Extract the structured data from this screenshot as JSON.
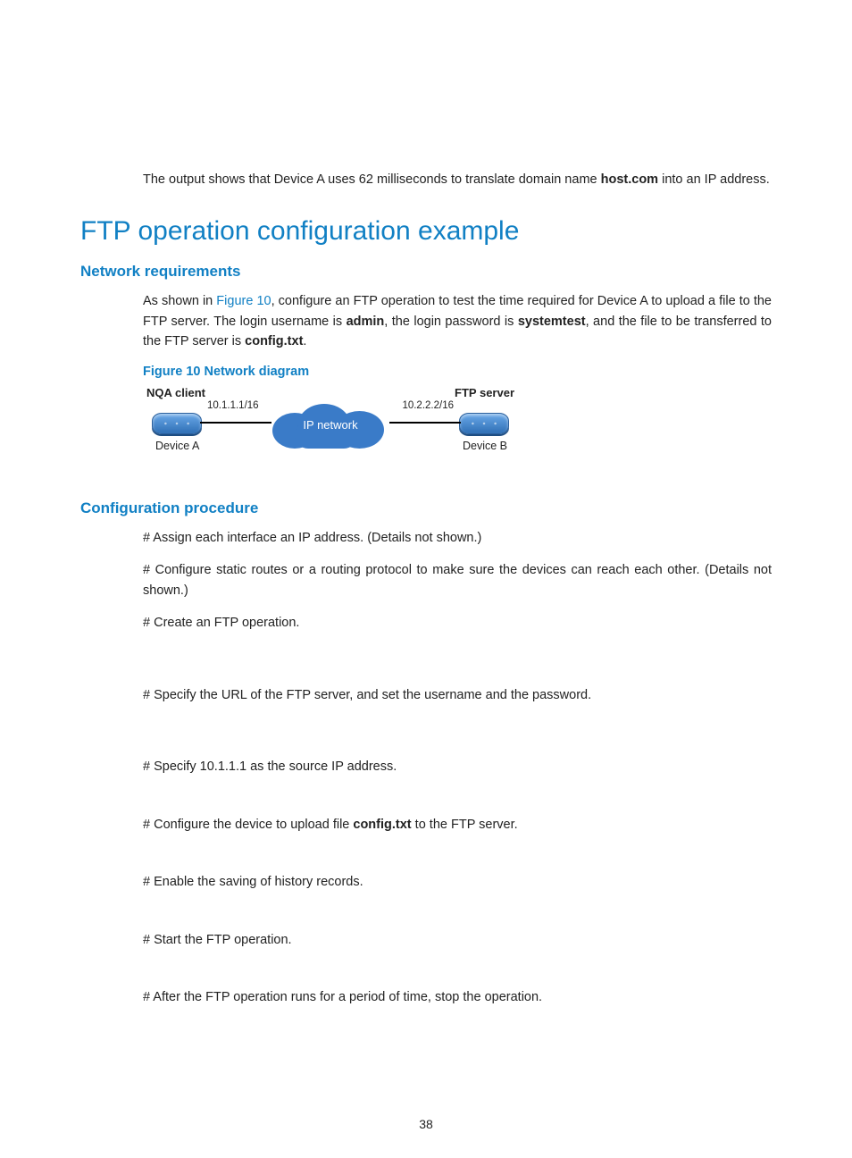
{
  "intro": {
    "pre": "The output shows that Device A uses 62 milliseconds to translate domain name ",
    "bold": "host.com",
    "post": " into an IP address."
  },
  "h2": "FTP operation configuration example",
  "netreq": {
    "title": "Network requirements",
    "p1a": "As shown in ",
    "link": "Figure 10",
    "p1b": ", configure an FTP operation to test the time required for Device A to upload a file to the FTP server. The login username is ",
    "b1": "admin",
    "p1c": ", the login password is ",
    "b2": "systemtest",
    "p1d": ", and the file to be transferred to the FTP server is ",
    "b3": "config.txt",
    "p1e": "."
  },
  "figcap": "Figure 10 Network diagram",
  "diagram": {
    "left_title": "NQA client",
    "right_title": "FTP server",
    "ip_a": "10.1.1.1/16",
    "ip_b": "10.2.2.2/16",
    "cloud": "IP network",
    "dev_a": "Device A",
    "dev_b": "Device B"
  },
  "proc": {
    "title": "Configuration procedure",
    "s1": "# Assign each interface an IP address. (Details not shown.)",
    "s2": "# Configure static routes or a routing protocol to make sure the devices can reach each other. (Details not shown.)",
    "s3": "# Create an FTP operation.",
    "s4": "# Specify the URL of the FTP server, and set the username and the password.",
    "s5": "# Specify 10.1.1.1 as the source IP address.",
    "s6a": "# Configure the device to upload file ",
    "s6b": "config.txt",
    "s6c": " to the FTP server.",
    "s7": "# Enable the saving of history records.",
    "s8": "# Start the FTP operation.",
    "s9": "# After the FTP operation runs for a period of time, stop the operation."
  },
  "pagenum": "38"
}
